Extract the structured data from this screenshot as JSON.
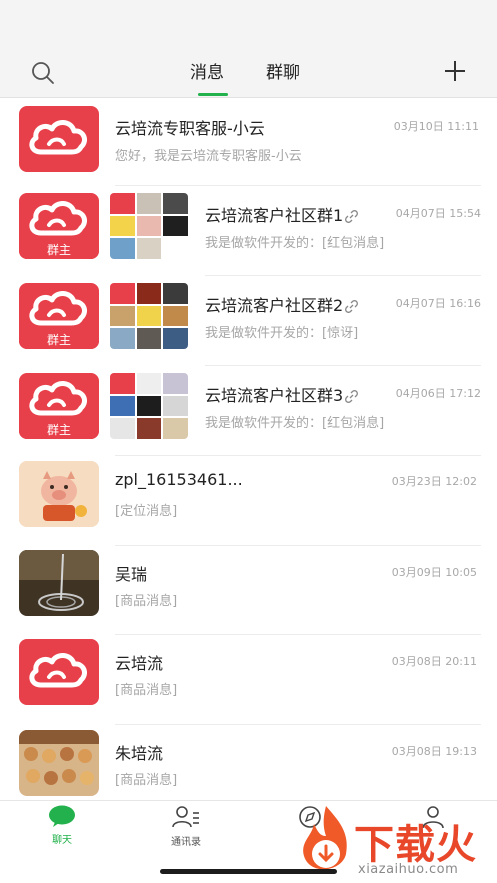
{
  "header": {
    "tabs": [
      {
        "label": "消息",
        "active": true
      },
      {
        "label": "群聊",
        "active": false
      }
    ],
    "accent": "#22b14c"
  },
  "conversations": [
    {
      "title": "云培流专职客服-小云",
      "time": "03月10日 11:11",
      "preview": "您好，我是云培流专职客服-小云",
      "avatar": "brand-logo"
    },
    {
      "title": "云培流客户社区群1",
      "time": "04月07日 15:54",
      "preview": "我是做软件开发的：[红包消息]",
      "avatar": "group",
      "badge": "群主",
      "linked": true
    },
    {
      "title": "云培流客户社区群2",
      "time": "04月07日 16:16",
      "preview": "我是做软件开发的：[惊讶]",
      "avatar": "group",
      "badge": "群主",
      "linked": true
    },
    {
      "title": "云培流客户社区群3",
      "time": "04月06日 17:12",
      "preview": "我是做软件开发的：[红包消息]",
      "avatar": "group",
      "badge": "群主",
      "linked": true
    },
    {
      "title": "zpl_16153461...",
      "time": "03月23日 12:02",
      "preview": "[定位消息]",
      "avatar": "pig-photo"
    },
    {
      "title": "吴瑞",
      "time": "03月09日 10:05",
      "preview": "[商品消息]",
      "avatar": "spoon-photo"
    },
    {
      "title": "云培流",
      "time": "03月08日 20:11",
      "preview": "[商品消息]",
      "avatar": "brand-logo"
    },
    {
      "title": "朱培流",
      "time": "03月08日 19:13",
      "preview": "[商品消息]",
      "avatar": "food-photo"
    }
  ],
  "bottom_nav": [
    {
      "label": "聊天",
      "icon": "chat-bubble-icon",
      "active": true
    },
    {
      "label": "通讯录",
      "icon": "contacts-icon",
      "active": false
    },
    {
      "label": "",
      "icon": "compass-icon",
      "active": false
    },
    {
      "label": "",
      "icon": "person-icon",
      "active": false
    }
  ],
  "watermark": {
    "text": "下载火",
    "url": "xiazaihuo.com"
  }
}
